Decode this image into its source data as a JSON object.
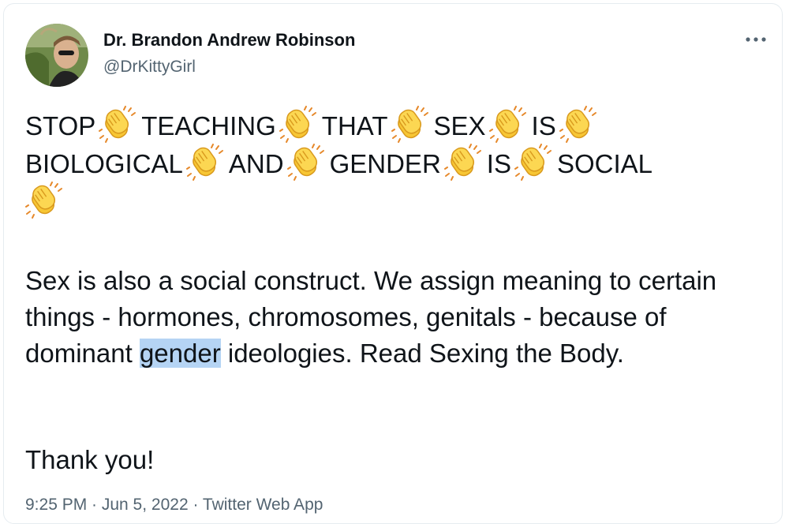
{
  "author": {
    "display_name": "Dr. Brandon Andrew Robinson",
    "handle": "@DrKittyGirl"
  },
  "tweet": {
    "clap_lines": [
      [
        "STOP",
        "TEACHING",
        "THAT",
        "SEX",
        "IS"
      ],
      [
        "BIOLOGICAL",
        "AND",
        "GENDER",
        "IS",
        "SOCIAL"
      ]
    ],
    "para1_before": "Sex is also a social construct. We assign meaning to certain things - hormones, chromosomes, genitals - because of dominant ",
    "para1_highlight": "gender",
    "para1_after": " ideologies. Read Sexing the Body.",
    "para2": "Thank you!"
  },
  "meta": {
    "timestamp_line": "9:25 PM · Jun 5, 2022 · Twitter Web App"
  },
  "icons": {
    "menu": "more-horizontal-icon",
    "emoji": "clapping-hands-icon"
  },
  "colors": {
    "text": "#0f1419",
    "secondary": "#536471",
    "highlight": "#b5d4f4",
    "clap": "#f7c634"
  }
}
